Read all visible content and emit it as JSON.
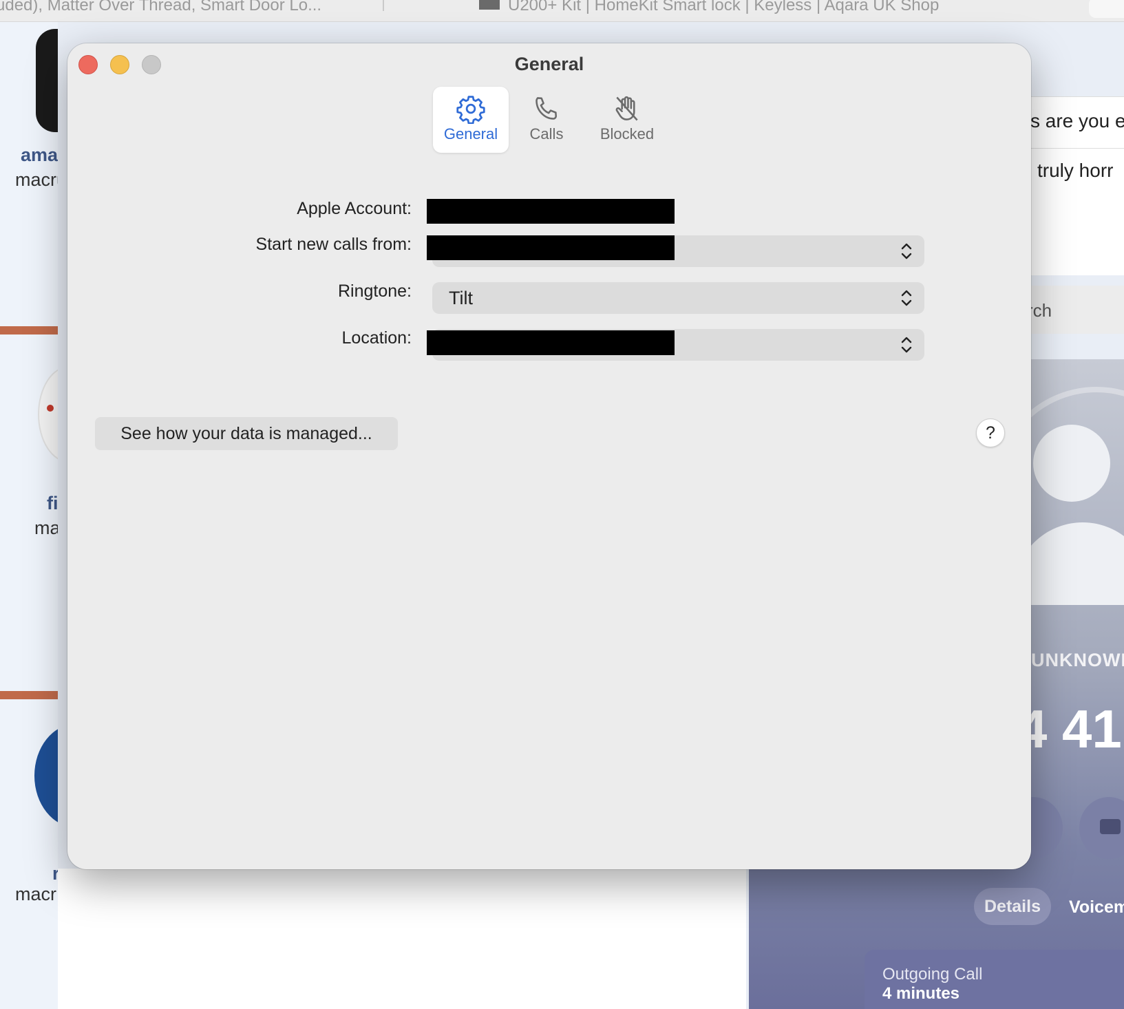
{
  "background": {
    "browser_tabs": [
      {
        "label": "uded), Matter Over Thread, Smart Door Lo..."
      },
      {
        "label": "U200+ Kit | HomeKit Smart lock | Keyless | Aqara UK Shop"
      }
    ],
    "left_items": [
      {
        "title": "ama",
        "subtitle": "macru"
      },
      {
        "title": "fi",
        "subtitle": "ma"
      },
      {
        "title": "r",
        "subtitle": "macr"
      }
    ],
    "right_texts": {
      "line1": "s are you e",
      "line2": "truly horr",
      "search": "rch"
    },
    "phone": {
      "caller": "UNKNOWN",
      "number": "4 41",
      "details_label": "Details",
      "voicemail_label": "Voicem",
      "card_title": "Outgoing Call",
      "card_subtitle": "4 minutes"
    }
  },
  "window": {
    "title": "General",
    "tabs": [
      {
        "label": "General",
        "icon": "gear-icon",
        "selected": true
      },
      {
        "label": "Calls",
        "icon": "phone-icon",
        "selected": false
      },
      {
        "label": "Blocked",
        "icon": "hand-icon",
        "selected": false
      }
    ],
    "accent_color": "#2f6bd6",
    "form": {
      "apple_account_label": "Apple Account:",
      "start_calls_label": "Start new calls from:",
      "ringtone_label": "Ringtone:",
      "ringtone_value": "Tilt",
      "location_label": "Location:"
    },
    "data_button_label": "See how your data is managed...",
    "help_button_label": "?"
  }
}
